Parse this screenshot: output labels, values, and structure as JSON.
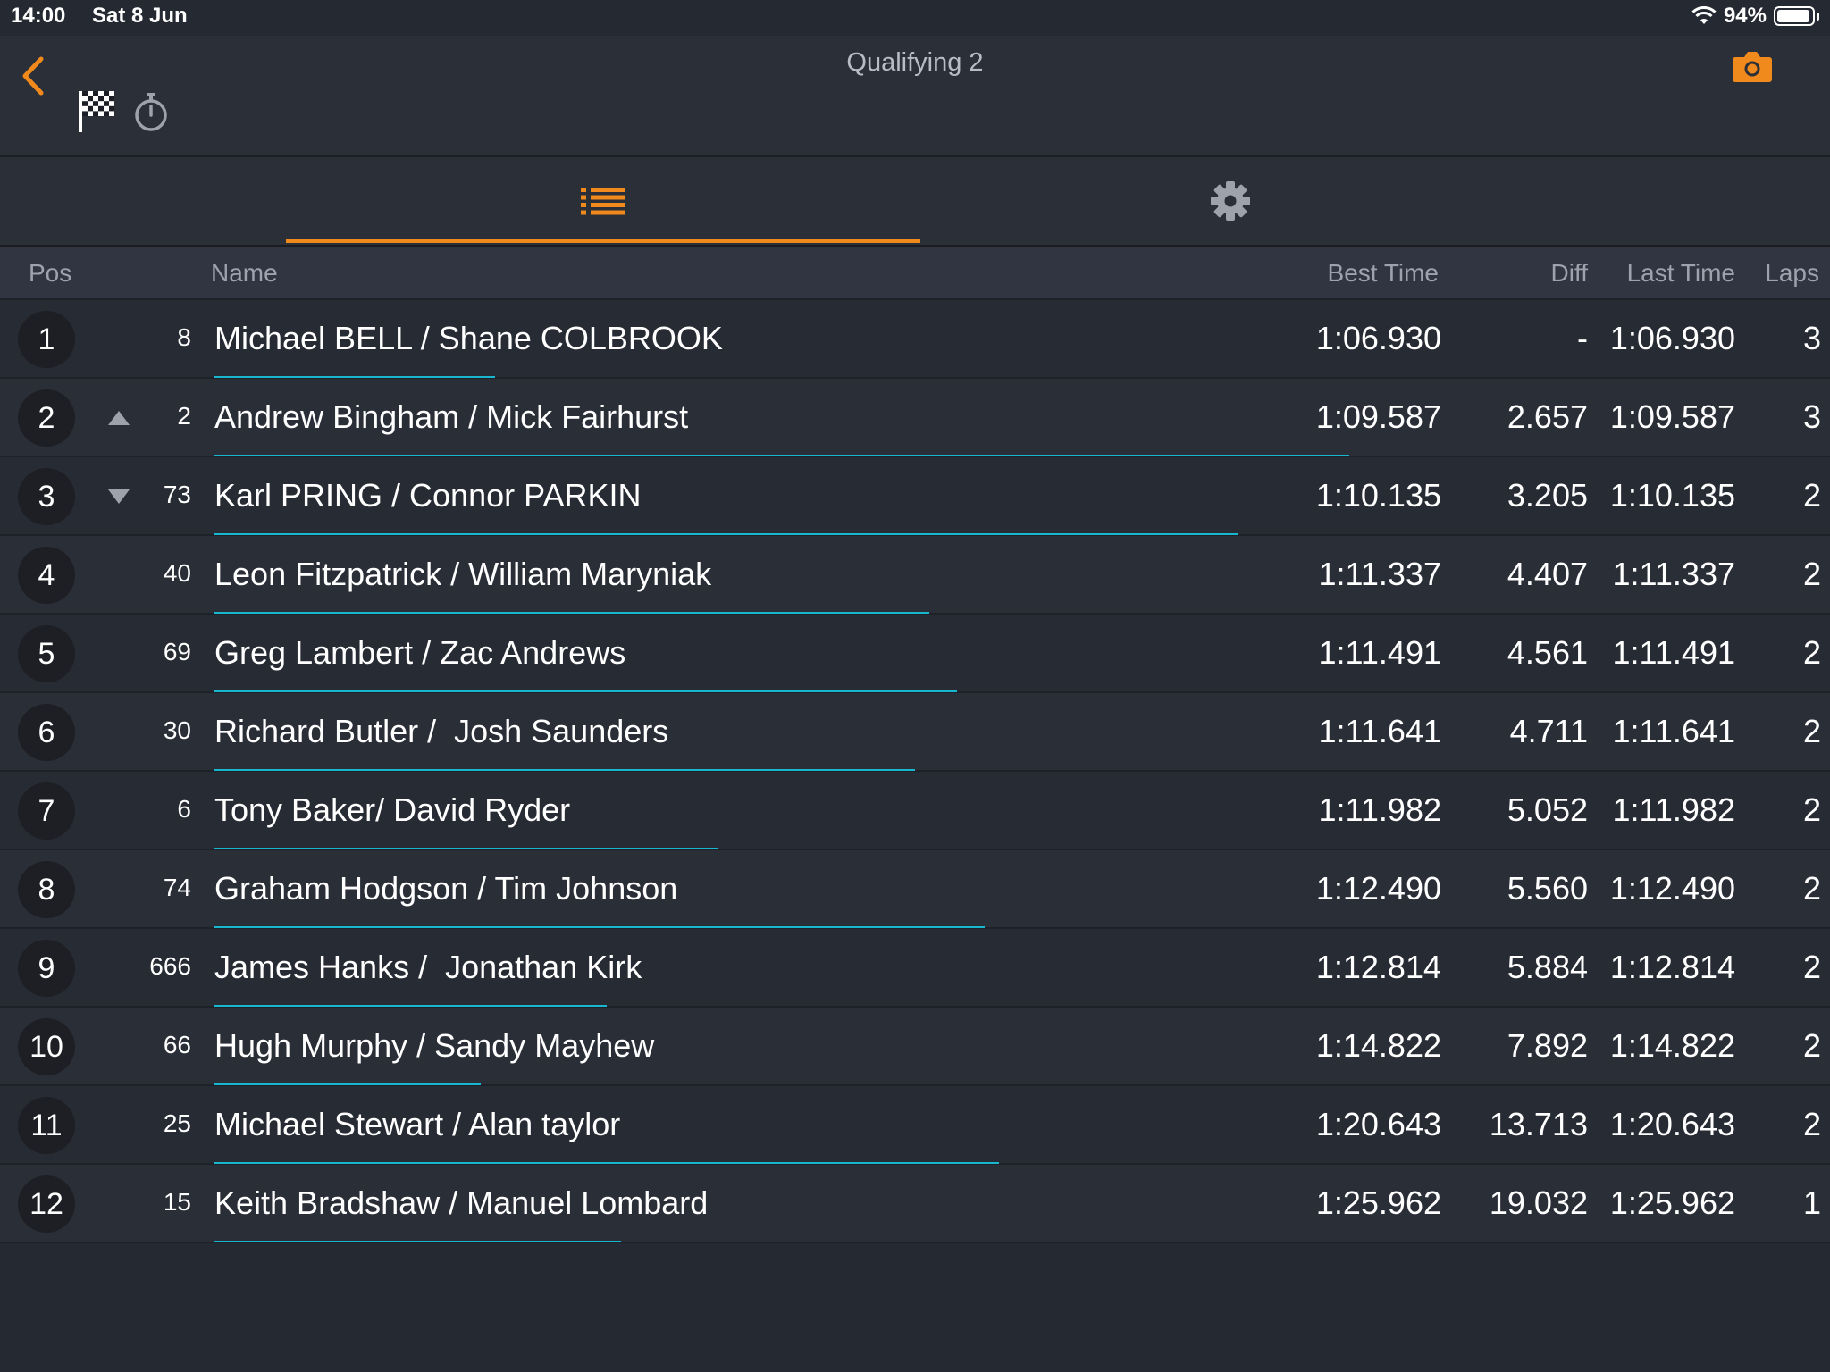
{
  "status_bar": {
    "time": "14:00",
    "date": "Sat 8 Jun",
    "battery": "94%",
    "battery_level": 0.94
  },
  "header": {
    "title": "Qualifying 2"
  },
  "icons": {
    "back": "chevron-left-icon",
    "camera": "camera-icon",
    "flag": "checkered-flag-icon",
    "stopwatch": "stopwatch-icon",
    "list": "list-icon",
    "settings": "gear-icon",
    "wifi": "wifi-icon",
    "battery": "battery-icon"
  },
  "colors": {
    "accent": "#f08a1c",
    "progress": "#19b6cf",
    "background": "#252931"
  },
  "columns": {
    "pos": "Pos",
    "name": "Name",
    "best_time": "Best Time",
    "diff": "Diff",
    "last_time": "Last Time",
    "laps": "Laps"
  },
  "rows": [
    {
      "pos": "1",
      "trend": "",
      "car": "8",
      "name": "Michael BELL / Shane COLBROOK",
      "best": "1:06.930",
      "diff": "-",
      "last": "1:06.930",
      "laps": "3",
      "progress": 0.2
    },
    {
      "pos": "2",
      "trend": "up",
      "car": "2",
      "name": "Andrew Bingham / Mick Fairhurst",
      "best": "1:09.587",
      "diff": "2.657",
      "last": "1:09.587",
      "laps": "3",
      "progress": 0.81
    },
    {
      "pos": "3",
      "trend": "down",
      "car": "73",
      "name": "Karl PRING / Connor PARKIN",
      "best": "1:10.135",
      "diff": "3.205",
      "last": "1:10.135",
      "laps": "2",
      "progress": 0.73
    },
    {
      "pos": "4",
      "trend": "",
      "car": "40",
      "name": "Leon Fitzpatrick / William Maryniak",
      "best": "1:11.337",
      "diff": "4.407",
      "last": "1:11.337",
      "laps": "2",
      "progress": 0.51
    },
    {
      "pos": "5",
      "trend": "",
      "car": "69",
      "name": "Greg Lambert / Zac Andrews",
      "best": "1:11.491",
      "diff": "4.561",
      "last": "1:11.491",
      "laps": "2",
      "progress": 0.53
    },
    {
      "pos": "6",
      "trend": "",
      "car": "30",
      "name": "Richard Butler /  Josh Saunders",
      "best": "1:11.641",
      "diff": "4.711",
      "last": "1:11.641",
      "laps": "2",
      "progress": 0.5
    },
    {
      "pos": "7",
      "trend": "",
      "car": "6",
      "name": "Tony Baker/ David Ryder",
      "best": "1:11.982",
      "diff": "5.052",
      "last": "1:11.982",
      "laps": "2",
      "progress": 0.36
    },
    {
      "pos": "8",
      "trend": "",
      "car": "74",
      "name": "Graham Hodgson / Tim Johnson",
      "best": "1:12.490",
      "diff": "5.560",
      "last": "1:12.490",
      "laps": "2",
      "progress": 0.55
    },
    {
      "pos": "9",
      "trend": "",
      "car": "666",
      "name": "James Hanks /  Jonathan Kirk",
      "best": "1:12.814",
      "diff": "5.884",
      "last": "1:12.814",
      "laps": "2",
      "progress": 0.28
    },
    {
      "pos": "10",
      "trend": "",
      "car": "66",
      "name": "Hugh Murphy / Sandy Mayhew",
      "best": "1:14.822",
      "diff": "7.892",
      "last": "1:14.822",
      "laps": "2",
      "progress": 0.19
    },
    {
      "pos": "11",
      "trend": "",
      "car": "25",
      "name": "Michael Stewart / Alan taylor",
      "best": "1:20.643",
      "diff": "13.713",
      "last": "1:20.643",
      "laps": "2",
      "progress": 0.56
    },
    {
      "pos": "12",
      "trend": "",
      "car": "15",
      "name": "Keith Bradshaw / Manuel Lombard",
      "best": "1:25.962",
      "diff": "19.032",
      "last": "1:25.962",
      "laps": "1",
      "progress": 0.29
    }
  ]
}
